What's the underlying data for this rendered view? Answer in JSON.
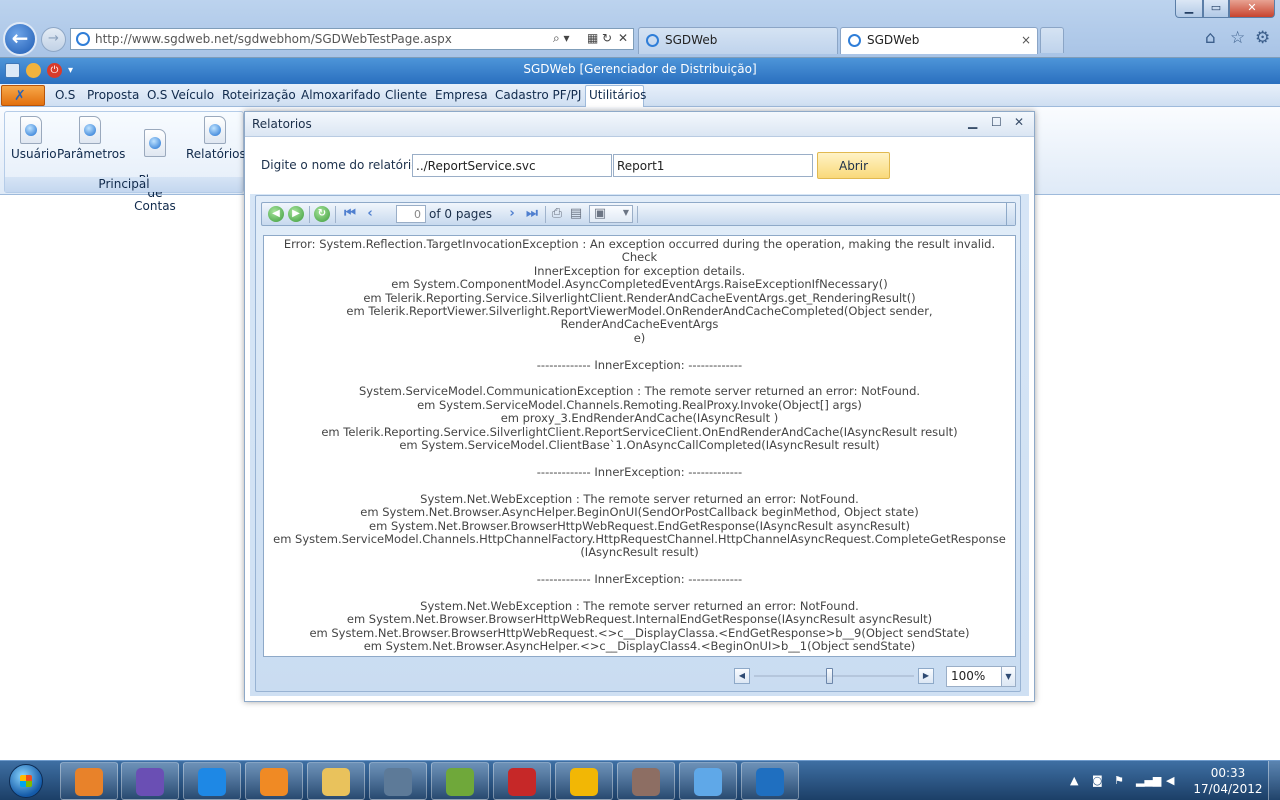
{
  "browser": {
    "url": "http://www.sgdweb.net/sgdwebhom/SGDWebTestPage.aspx",
    "tabs": [
      {
        "label": "SGDWeb"
      },
      {
        "label": "SGDWeb"
      }
    ],
    "tab_close": "×"
  },
  "app": {
    "title": "SGDWeb [Gerenciador de Distribuição]"
  },
  "menu": {
    "items": [
      "O.S",
      "Proposta",
      "O.S Veículo",
      "Roteirização",
      "Almoxarifado",
      "Cliente",
      "Empresa",
      "Cadastro PF/PJ",
      "Utilitários"
    ],
    "active": "Utilitários"
  },
  "ribbon": {
    "group_label": "Principal",
    "buttons": [
      {
        "label": "Usuário"
      },
      {
        "label": "Parâmetros"
      },
      {
        "label": "Plano\nde Contas"
      },
      {
        "label": "Relatórios"
      }
    ]
  },
  "modal": {
    "title": "Relatorios",
    "report_label": "Digite o nome do relatório",
    "service_url": "../ReportService.svc",
    "report_name": "Report1",
    "open_button": "Abrir"
  },
  "viewer": {
    "page_number": "0",
    "page_count_label": "of 0 pages",
    "zoom": "100%",
    "error_text": "Error: System.Reflection.TargetInvocationException : An exception occurred during the operation, making the result invalid.  Check\nInnerException for exception details.\nem System.ComponentModel.AsyncCompletedEventArgs.RaiseExceptionIfNecessary()\nem Telerik.Reporting.Service.SilverlightClient.RenderAndCacheEventArgs.get_RenderingResult()\nem Telerik.ReportViewer.Silverlight.ReportViewerModel.OnRenderAndCacheCompleted(Object sender, RenderAndCacheEventArgs\ne)\n\n------------- InnerException: -------------\n\nSystem.ServiceModel.CommunicationException : The remote server returned an error: NotFound.\nem System.ServiceModel.Channels.Remoting.RealProxy.Invoke(Object[] args)\nem proxy_3.EndRenderAndCache(IAsyncResult )\nem Telerik.Reporting.Service.SilverlightClient.ReportServiceClient.OnEndRenderAndCache(IAsyncResult result)\nem System.ServiceModel.ClientBase`1.OnAsyncCallCompleted(IAsyncResult result)\n\n------------- InnerException: -------------\n\nSystem.Net.WebException : The remote server returned an error: NotFound.\nem System.Net.Browser.AsyncHelper.BeginOnUI(SendOrPostCallback beginMethod, Object state)\nem System.Net.Browser.BrowserHttpWebRequest.EndGetResponse(IAsyncResult asyncResult)\nem System.ServiceModel.Channels.HttpChannelFactory.HttpRequestChannel.HttpChannelAsyncRequest.CompleteGetResponse\n(IAsyncResult result)\n\n------------- InnerException: -------------\n\nSystem.Net.WebException : The remote server returned an error: NotFound.\nem System.Net.Browser.BrowserHttpWebRequest.InternalEndGetResponse(IAsyncResult asyncResult)\nem System.Net.Browser.BrowserHttpWebRequest.<>c__DisplayClassa.<EndGetResponse>b__9(Object sendState)\nem System.Net.Browser.AsyncHelper.<>c__DisplayClass4.<BeginOnUI>b__1(Object sendState)"
  },
  "taskbar": {
    "apps": [
      {
        "icon": "mail-icon",
        "color": "#e8822a"
      },
      {
        "icon": "visual-studio-icon",
        "color": "#6a4fb4"
      },
      {
        "icon": "internet-explorer-icon",
        "color": "#1e88e5"
      },
      {
        "icon": "media-player-icon",
        "color": "#f08a24"
      },
      {
        "icon": "file-explorer-icon",
        "color": "#e9c25c"
      },
      {
        "icon": "database-icon",
        "color": "#5d7a98"
      },
      {
        "icon": "edit-plus-icon",
        "color": "#6fa83a"
      },
      {
        "icon": "filezilla-icon",
        "color": "#c62828"
      },
      {
        "icon": "chrome-icon",
        "color": "#f2b705"
      },
      {
        "icon": "music-app-icon",
        "color": "#8d6e63"
      },
      {
        "icon": "google-talk-icon",
        "color": "#5fa8e8"
      },
      {
        "icon": "remote-desktop-icon",
        "color": "#1f6fc0"
      }
    ],
    "clock_time": "00:33",
    "clock_date": "17/04/2012"
  }
}
